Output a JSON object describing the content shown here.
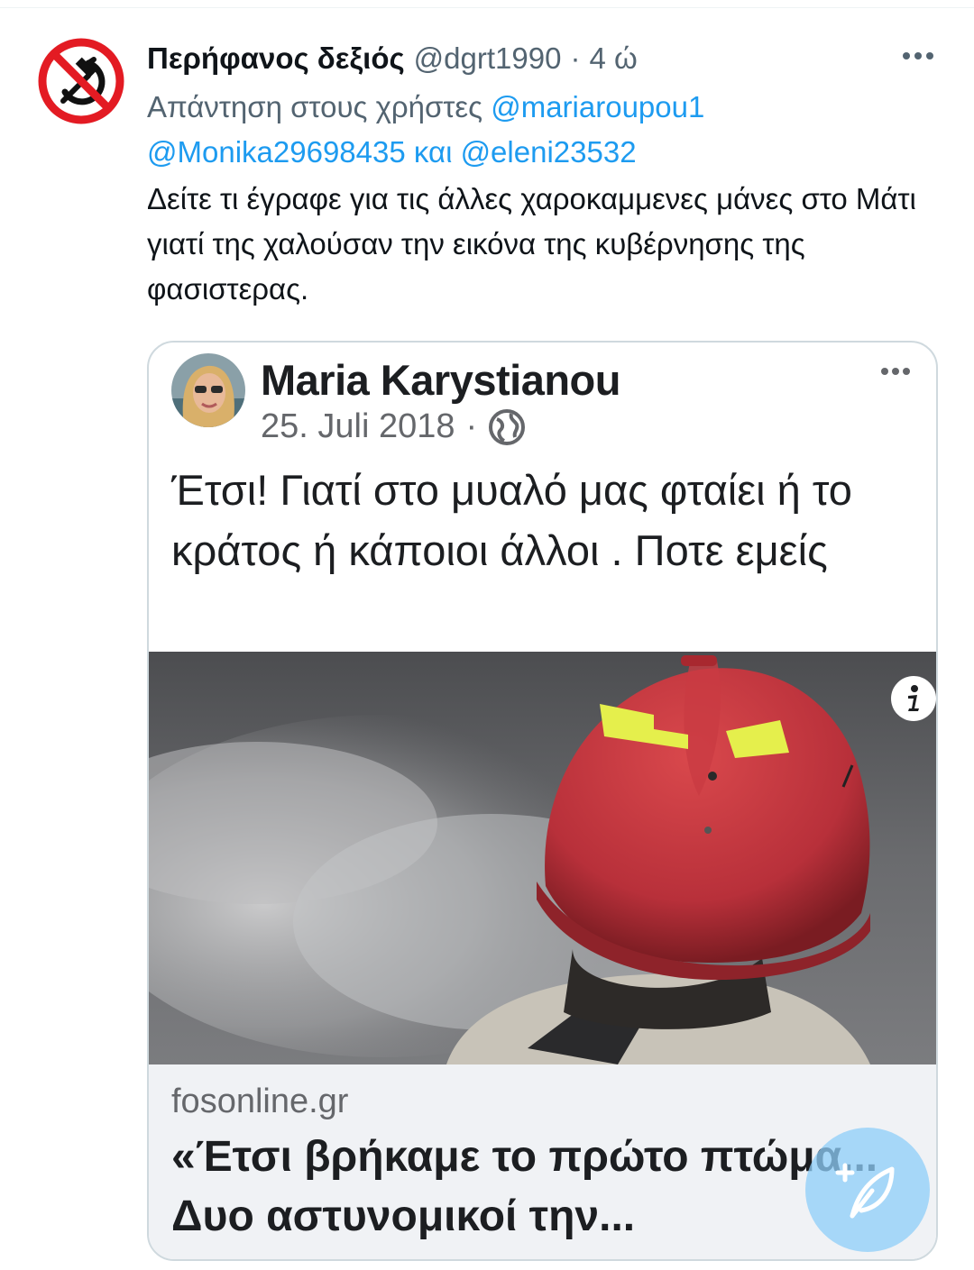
{
  "tweet": {
    "display_name": "Περήφανος δεξιός",
    "handle": "@dgrt1990",
    "separator": "·",
    "time": "4 ώ",
    "avatar_icon": "no-communism-symbol-icon",
    "reply_prefix": "Απάντηση στους χρήστες ",
    "mention_1": "@mariaroupou1",
    "mention_2": "@Monika29698435",
    "reply_and": " και ",
    "mention_3": "@eleni23532",
    "text": "Δείτε τι έγραφε για τις άλλες χαροκαμμενες μάνες στο Μάτι γιατί της χαλούσαν την εικόνα της κυβέρνησης της φασιστερας."
  },
  "card": {
    "author": "Maria Karystianou",
    "date": "25. Juli 2018",
    "separator": "·",
    "post_text": "Έτσι!  Γιατί στο μυαλό μας φταίει ή το κράτος ή κάποιοι άλλοι . Ποτε εμείς",
    "photo_alt": "firefighter-with-red-helmet-and-smoke",
    "link_domain": "fosonline.gr",
    "link_title": "«Έτσι βρήκαμε το πρώτο πτώμα... Δυο αστυνομικοί την..."
  },
  "colors": {
    "link_blue": "#1d9bf0",
    "secondary_text": "#536471",
    "helmet_red": "#c0343a",
    "fab_blue": "#8ecdf8"
  }
}
